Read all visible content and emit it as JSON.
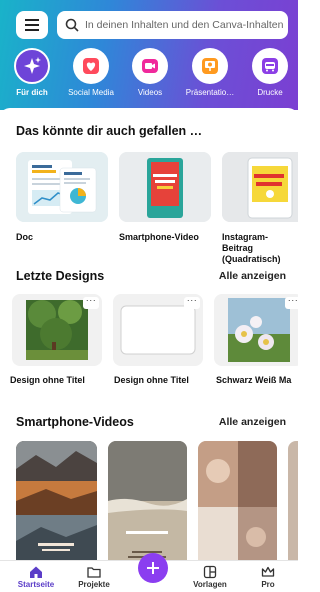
{
  "search": {
    "placeholder": "In deinen Inhalten und den Canva-Inhalten"
  },
  "categories": [
    {
      "label": "Für dich",
      "icon": "sparkle-icon",
      "active": true
    },
    {
      "label": "Social Media",
      "icon": "heart-icon"
    },
    {
      "label": "Videos",
      "icon": "video-camera-icon"
    },
    {
      "label": "Präsentatio…",
      "icon": "presentation-icon"
    },
    {
      "label": "Drucke",
      "icon": "print-bus-icon"
    }
  ],
  "suggestions": {
    "title": "Das könnte dir auch gefallen …",
    "items": [
      {
        "label": "Doc",
        "thumb_text": "Designe Flowiz Docs"
      },
      {
        "label": "Smartphone-Video",
        "thumb_text": "SONG VERB DONG MEIN"
      },
      {
        "label": "Instagram-Beitrag (Quadratisch)",
        "thumb_text": "OPTIMIERE DEINEN POST"
      }
    ]
  },
  "recent": {
    "title": "Letzte Designs",
    "see_all": "Alle anzeigen",
    "items": [
      {
        "label": "Design ohne Titel"
      },
      {
        "label": "Design ohne Titel"
      },
      {
        "label": "Schwarz Weiß Ma"
      }
    ]
  },
  "videos": {
    "title": "Smartphone-Videos",
    "see_all": "Alle anzeigen",
    "thumb_texts": [
      "",
      "",
      ""
    ]
  },
  "nav": {
    "home": "Startseite",
    "projects": "Projekte",
    "templates": "Vorlagen",
    "pro": "Pro"
  },
  "colors": {
    "accent": "#7d2ae8",
    "fab": "#8b3ef0",
    "active_tab": "#5b3dc8"
  }
}
